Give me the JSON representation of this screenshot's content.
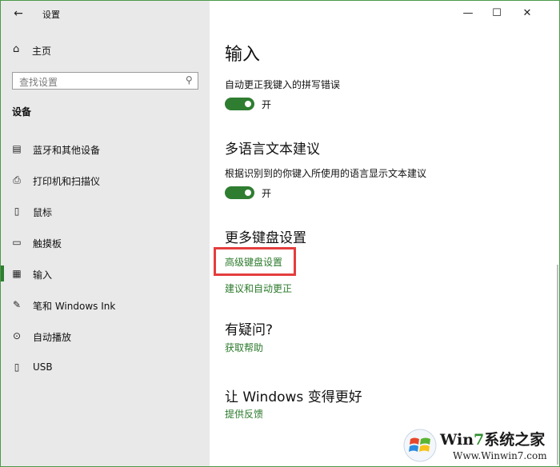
{
  "window": {
    "title": "设置",
    "controls": {
      "minimize": "—",
      "maximize": "☐",
      "close": "✕"
    }
  },
  "sidebar": {
    "home_label": "主页",
    "search_placeholder": "查找设置",
    "section_title": "设备",
    "items": [
      {
        "label": "蓝牙和其他设备",
        "icon": "bluetooth-devices-icon",
        "glyph": "▤"
      },
      {
        "label": "打印机和扫描仪",
        "icon": "printer-icon",
        "glyph": "⎙"
      },
      {
        "label": "鼠标",
        "icon": "mouse-icon",
        "glyph": "▯"
      },
      {
        "label": "触摸板",
        "icon": "touchpad-icon",
        "glyph": "▭"
      },
      {
        "label": "输入",
        "icon": "keyboard-icon",
        "glyph": "▦",
        "active": true
      },
      {
        "label": "笔和 Windows Ink",
        "icon": "pen-icon",
        "glyph": "✎"
      },
      {
        "label": "自动播放",
        "icon": "autoplay-icon",
        "glyph": "⊙"
      },
      {
        "label": "USB",
        "icon": "usb-icon",
        "glyph": "▯"
      }
    ]
  },
  "main": {
    "title": "输入",
    "autocorrect": {
      "description": "自动更正我键入的拼写错误",
      "state": "开",
      "on": true
    },
    "multilingual": {
      "heading": "多语言文本建议",
      "description": "根据识别到的你键入所使用的语言显示文本建议",
      "state": "开",
      "on": true
    },
    "more_keyboard": {
      "heading": "更多键盘设置",
      "links": [
        "高级键盘设置",
        "建议和自动更正"
      ]
    },
    "questions": {
      "heading": "有疑问?",
      "link": "获取帮助"
    },
    "improve": {
      "heading": "让 Windows 变得更好",
      "link": "提供反馈"
    }
  },
  "colors": {
    "accent": "#2f7d31",
    "link": "#2b7a2b",
    "highlight": "#e43d3d",
    "sidebar_bg": "#e9e9e9"
  },
  "watermark": {
    "name_prefix": "Win",
    "name_seven": "7",
    "name_suffix": "系统之家",
    "url": "Www.Winwin7.com"
  }
}
